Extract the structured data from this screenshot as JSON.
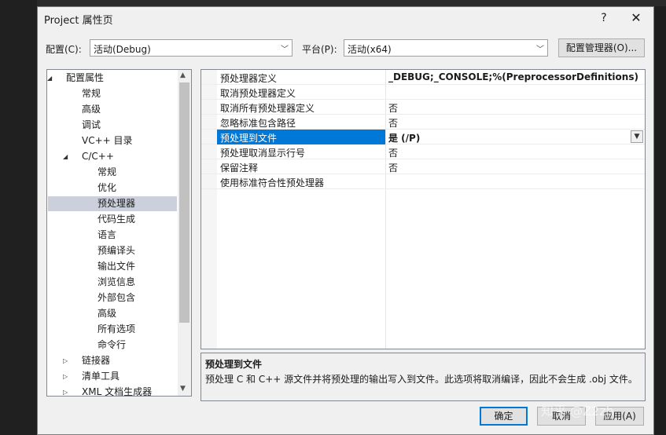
{
  "window": {
    "title": "Project 属性页",
    "help": "?",
    "close": "✕"
  },
  "toolbar": {
    "config_label": "配置(C):",
    "config_value": "活动(Debug)",
    "platform_label": "平台(P):",
    "platform_value": "活动(x64)",
    "config_manager": "配置管理器(O)..."
  },
  "tree": {
    "items": [
      {
        "label": "配置属性",
        "expander": "◢"
      },
      {
        "label": "常规"
      },
      {
        "label": "高级"
      },
      {
        "label": "调试"
      },
      {
        "label": "VC++ 目录"
      },
      {
        "label": "C/C++",
        "expander": "◢"
      },
      {
        "label": "常规"
      },
      {
        "label": "优化"
      },
      {
        "label": "预处理器",
        "selected": true
      },
      {
        "label": "代码生成"
      },
      {
        "label": "语言"
      },
      {
        "label": "预编译头"
      },
      {
        "label": "输出文件"
      },
      {
        "label": "浏览信息"
      },
      {
        "label": "外部包含"
      },
      {
        "label": "高级"
      },
      {
        "label": "所有选项"
      },
      {
        "label": "命令行"
      },
      {
        "label": "链接器",
        "expander": "▷"
      },
      {
        "label": "清单工具",
        "expander": "▷"
      },
      {
        "label": "XML 文档生成器",
        "expander": "▷"
      }
    ]
  },
  "grid": {
    "rows": [
      {
        "name": "预处理器定义",
        "value": "_DEBUG;_CONSOLE;%(PreprocessorDefinitions)",
        "bold": true
      },
      {
        "name": "取消预处理器定义",
        "value": ""
      },
      {
        "name": "取消所有预处理器定义",
        "value": "否"
      },
      {
        "name": "忽略标准包含路径",
        "value": "否"
      },
      {
        "name": "预处理到文件",
        "value": "是 (/P)",
        "bold": true,
        "selected": true
      },
      {
        "name": "预处理取消显示行号",
        "value": "否"
      },
      {
        "name": "保留注释",
        "value": "否"
      },
      {
        "name": "使用标准符合性预处理器",
        "value": ""
      }
    ]
  },
  "description": {
    "title": "预处理到文件",
    "text": "预处理 C 和 C++ 源文件并将预处理的输出写入到文件。此选项将取消编译，因此不会生成 .obj 文件。"
  },
  "buttons": {
    "ok": "确定",
    "cancel": "取消",
    "apply": "应用(A)"
  },
  "watermark": "知乎 @Z2zh",
  "colors": {
    "selection": "#0078d7",
    "tree_selection": "#ccd0dd"
  }
}
